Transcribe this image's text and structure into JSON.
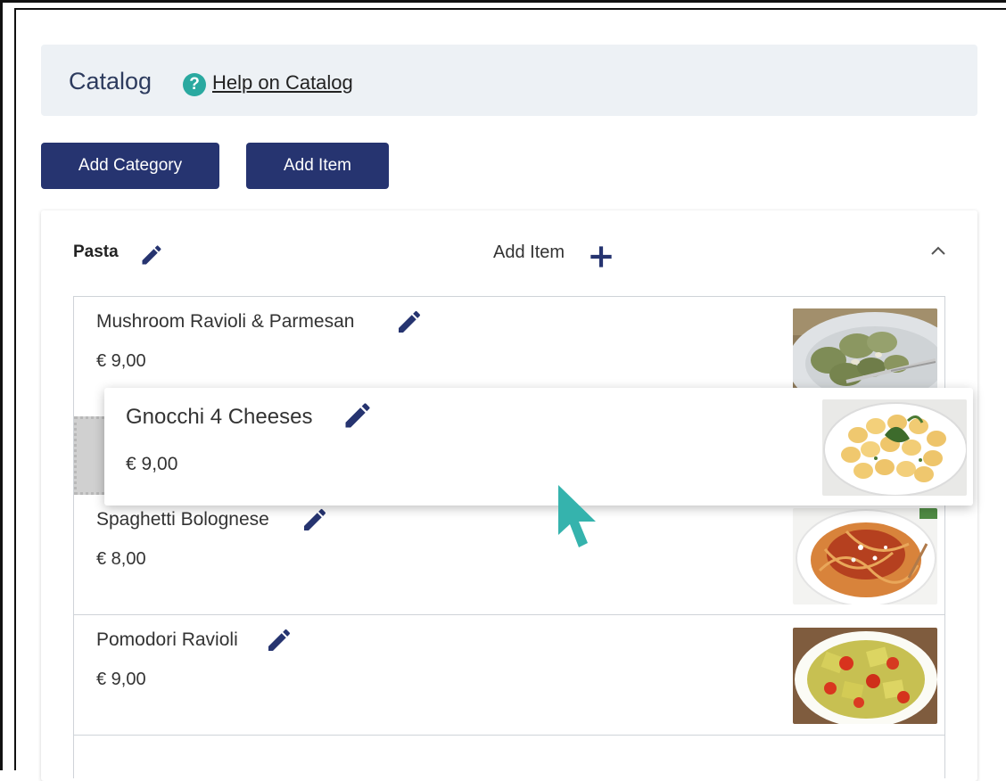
{
  "header": {
    "title": "Catalog",
    "help_icon": "question-circle-icon",
    "help_link": "Help on Catalog"
  },
  "toolbar": {
    "add_category_label": "Add Category",
    "add_item_label": "Add Item"
  },
  "category": {
    "name": "Pasta",
    "add_item_label": "Add Item",
    "items": [
      {
        "name": "Mushroom Ravioli & Parmesan",
        "price": "€ 9,00"
      },
      {
        "name": "Spaghetti Bolognese",
        "price": "€ 8,00"
      },
      {
        "name": "Pomodori Ravioli",
        "price": "€ 9,00"
      }
    ],
    "dragging_item": {
      "name": "Gnocchi 4 Cheeses",
      "price": "€ 9,00"
    }
  },
  "colors": {
    "primary": "#263470",
    "accent": "#2aa9a0",
    "header_bg": "#edf1f5"
  }
}
